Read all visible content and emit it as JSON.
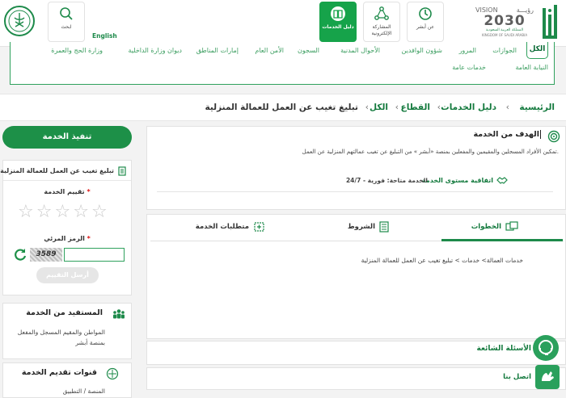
{
  "header": {
    "logo_vision_en": "VISION",
    "logo_vision_ar": "رؤيـــة",
    "logo_year": "2030",
    "logo_kingdom_ar": "المملكة العربية السعودية",
    "logo_kingdom_en": "KINGDOM OF SAUDI ARABIA",
    "absher_brand": "أبشر",
    "tiles": [
      {
        "label": "عن أبشر",
        "icon": "clock-check-icon"
      },
      {
        "label": "المشاركة الإلكترونية",
        "icon": "people-share-icon"
      },
      {
        "label": "دليل الخدمات",
        "icon": "book-icon",
        "active": true
      }
    ],
    "english_link": "English",
    "search_label": "ابحث"
  },
  "categories": {
    "active": "الكل",
    "row1": [
      "الجوازات",
      "المرور",
      "شؤون الوافدين",
      "الأحوال المدنية",
      "السجون",
      "الأمن العام",
      "إمارات المناطق",
      "ديوان وزارة الداخلية",
      "وزارة الحج والعمرة"
    ],
    "row2": [
      "النيابة العامة",
      "خدمات عامة"
    ]
  },
  "breadcrumb": {
    "items": [
      "الرئيسية",
      "دليل الخدمات",
      "القطاع",
      "الكل"
    ],
    "current": "تبليغ تغيب عن العمل للعمالة المنزلية"
  },
  "goal": {
    "title": "الهدف من الخدمة",
    "description": "تمكين الأفراد المسجلين والمقيمين والمفعلين بمنصة «أبشر » من التبليغ عن تغيب عمالتهم المنزلية عن العمل.",
    "sla_link": "اتفاقية مستوى الخدمة",
    "availability": "الخدمة متاحة: فورية - 24/7"
  },
  "tabs": {
    "items": [
      "الخطوات",
      "الشروط",
      "متطلبات الخدمة"
    ],
    "active": "الخطوات",
    "steps_text": "خدمات العمالة> خدمات > تبليغ تغيب عن العمل للعمالة المنزلية"
  },
  "faq": {
    "title": "الأسئلة الشائعة"
  },
  "contact": {
    "title": "اتصل بنا"
  },
  "sidebar": {
    "execute_button": "تنفيذ الخدمة",
    "service_title": "تبليغ تغيب عن العمل للعمالة المنزلية",
    "rating_label": "تقييم الخدمة",
    "stars": 5,
    "captcha_label": "الرمز المرئي",
    "captcha_value": "3589",
    "captcha_input": "",
    "send_button": "أرسل التقييم",
    "beneficiary_title": "المستفيد من الخدمة",
    "beneficiary_text": "المواطن والمقيم المسجل والمفعل بمنصة أبشر",
    "channels_title": "قنوات تقديم الخدمة",
    "channels_text": "المنصة / التطبيق"
  },
  "colors": {
    "brand_green": "#1d9048",
    "link_green": "#147a3e",
    "required_red": "#d11"
  }
}
